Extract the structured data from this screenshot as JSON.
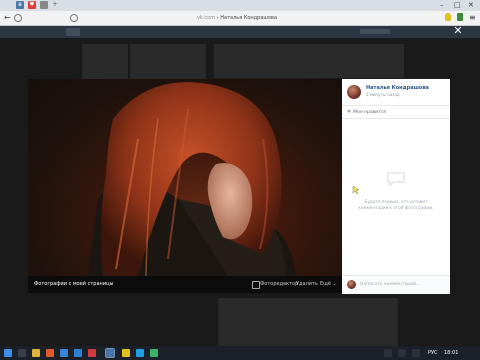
{
  "browser": {
    "url_domain": "vk.com",
    "url_sep": " › ",
    "page_title": "Наталья Кондрашова",
    "window_min": "–",
    "window_max": "□",
    "window_close": "✕",
    "back": "←",
    "menu": "≡"
  },
  "viewer": {
    "close_label": "✕",
    "album_caption": "Фотографии с моей страницы",
    "actions": {
      "photo_editor": "Фоторедактор",
      "delete": "Удалить",
      "more": "Ещё ⌄"
    }
  },
  "panel": {
    "author_name": "Наталья Кондрашова",
    "post_date": "2 минуты назад",
    "likes_text": "Мне нравится",
    "empty_comments_text": "Будьте первым, кто оставит комментарий к этой фотографии.",
    "comment_placeholder": "Написать комментарий..."
  },
  "taskbar": {
    "lang": "РУС",
    "time": "18:01",
    "icons": [
      "start-icon",
      "task-view-icon",
      "explorer-icon",
      "browser-icon",
      "store-icon",
      "mail-icon",
      "media-icon",
      "vk-icon",
      "yandex-browser-icon",
      "skype-icon",
      "app-icon"
    ]
  },
  "colors": {
    "accent": "#2a5885",
    "vk_header": "#2b3643",
    "overlay": "#1a1a1a"
  }
}
